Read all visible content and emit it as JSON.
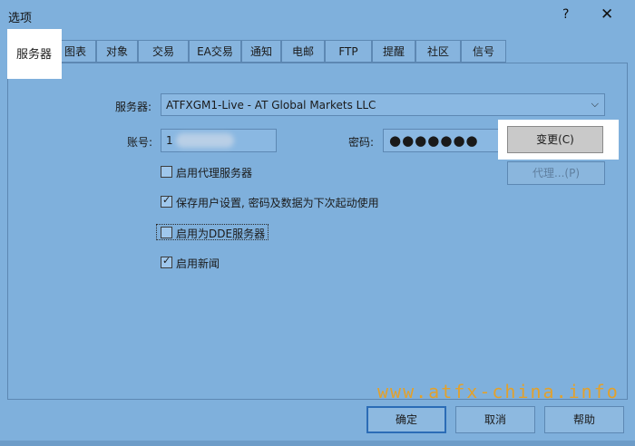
{
  "window": {
    "title": "选项",
    "help": "?",
    "close": "✕"
  },
  "tabs": [
    {
      "label": "服务器"
    },
    {
      "label": "图表"
    },
    {
      "label": "对象"
    },
    {
      "label": "交易"
    },
    {
      "label": "EA交易"
    },
    {
      "label": "通知"
    },
    {
      "label": "电邮"
    },
    {
      "label": "FTP"
    },
    {
      "label": "提醒"
    },
    {
      "label": "社区"
    },
    {
      "label": "信号"
    }
  ],
  "server": {
    "label": "服务器:",
    "value": "ATFXGM1-Live - AT Global Markets LLC",
    "account_label": "账号:",
    "account_value": "1",
    "password_label": "密码:",
    "password_value": "●●●●●●●",
    "change_button": "变更(C)",
    "proxy_button": "代理...(P)"
  },
  "options": [
    {
      "label": "启用代理服务器",
      "checked": false
    },
    {
      "label": "保存用户设置, 密码及数据为下次起动使用",
      "checked": true
    },
    {
      "label": "启用为DDE服务器",
      "checked": false
    },
    {
      "label": "启用新闻",
      "checked": true
    }
  ],
  "footer": {
    "ok": "确定",
    "cancel": "取消",
    "help": "帮助"
  },
  "watermark": "www.atfx-china.info"
}
